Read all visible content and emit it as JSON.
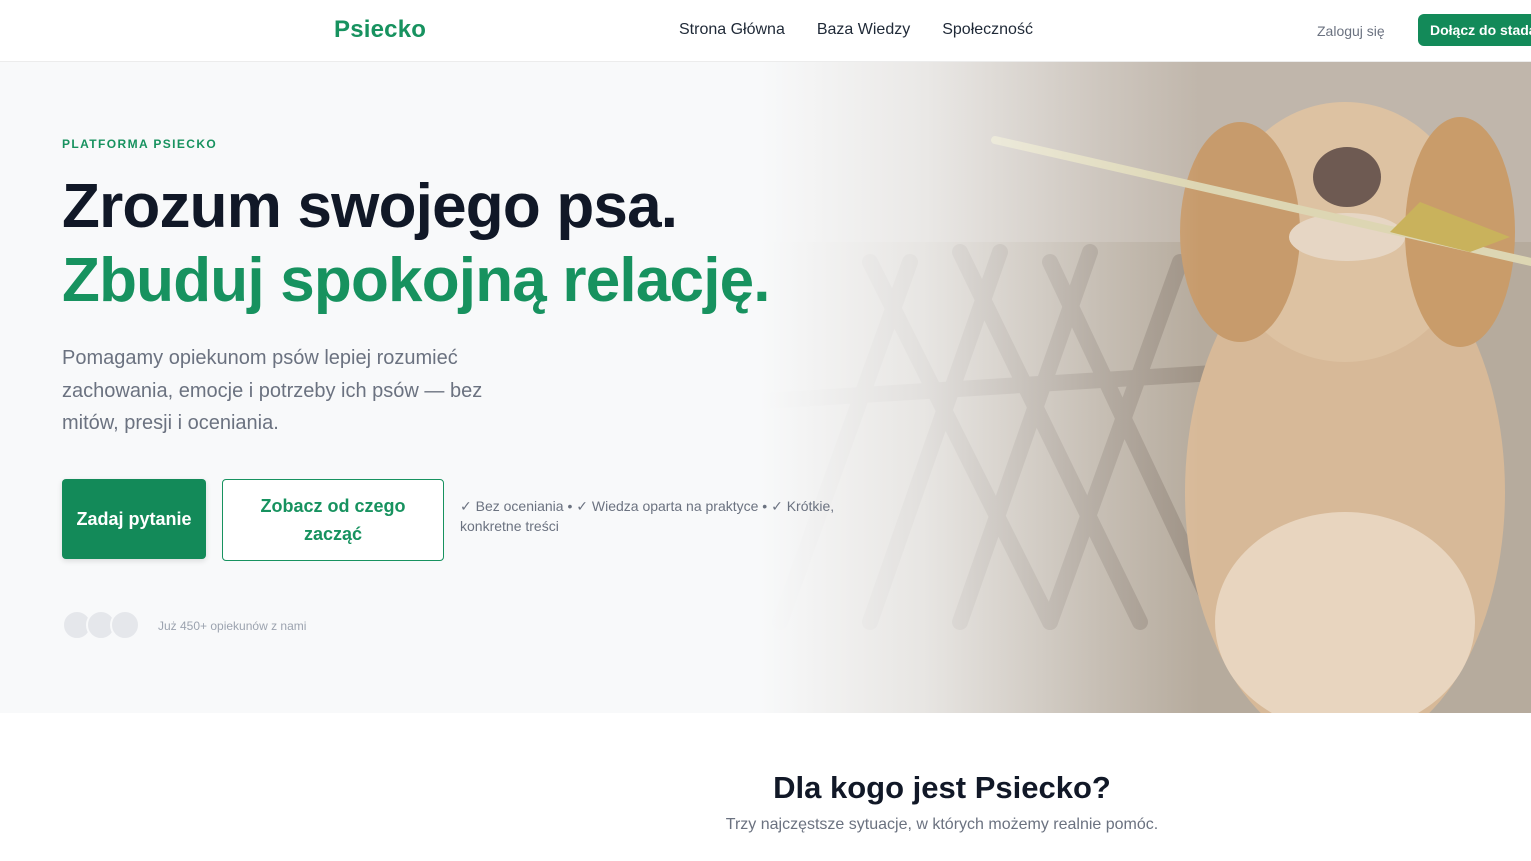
{
  "header": {
    "logo": "Psiecko",
    "nav": [
      {
        "label": "Strona Główna"
      },
      {
        "label": "Baza Wiedzy"
      },
      {
        "label": "Społeczność"
      }
    ],
    "login_label": "Zaloguj się",
    "join_label": "Dołącz do stada"
  },
  "hero": {
    "eyebrow": "PLATFORMA PSIECKO",
    "title_line1": "Zrozum swojego psa.",
    "title_line2": "Zbuduj spokojną relację.",
    "description": "Pomagamy opiekunom psów lepiej rozumieć zachowania, emocje i potrzeby ich psów — bez mitów, presji i oceniania.",
    "primary_button": "Zadaj pytanie",
    "secondary_button": "Zobacz od czego zacząć",
    "trust_line": "✓ Bez oceniania • ✓ Wiedza oparta na praktyce • ✓ Krótkie, konkretne treści",
    "community_text": "Już 450+ opiekunów z nami"
  },
  "section": {
    "title": "Dla kogo jest Psiecko?",
    "subtitle": "Trzy najczęstsze sytuacje, w których możemy realnie pomóc."
  },
  "colors": {
    "brand_green": "#17925f",
    "button_green": "#138a59",
    "hero_bg": "#f8f9fa"
  }
}
